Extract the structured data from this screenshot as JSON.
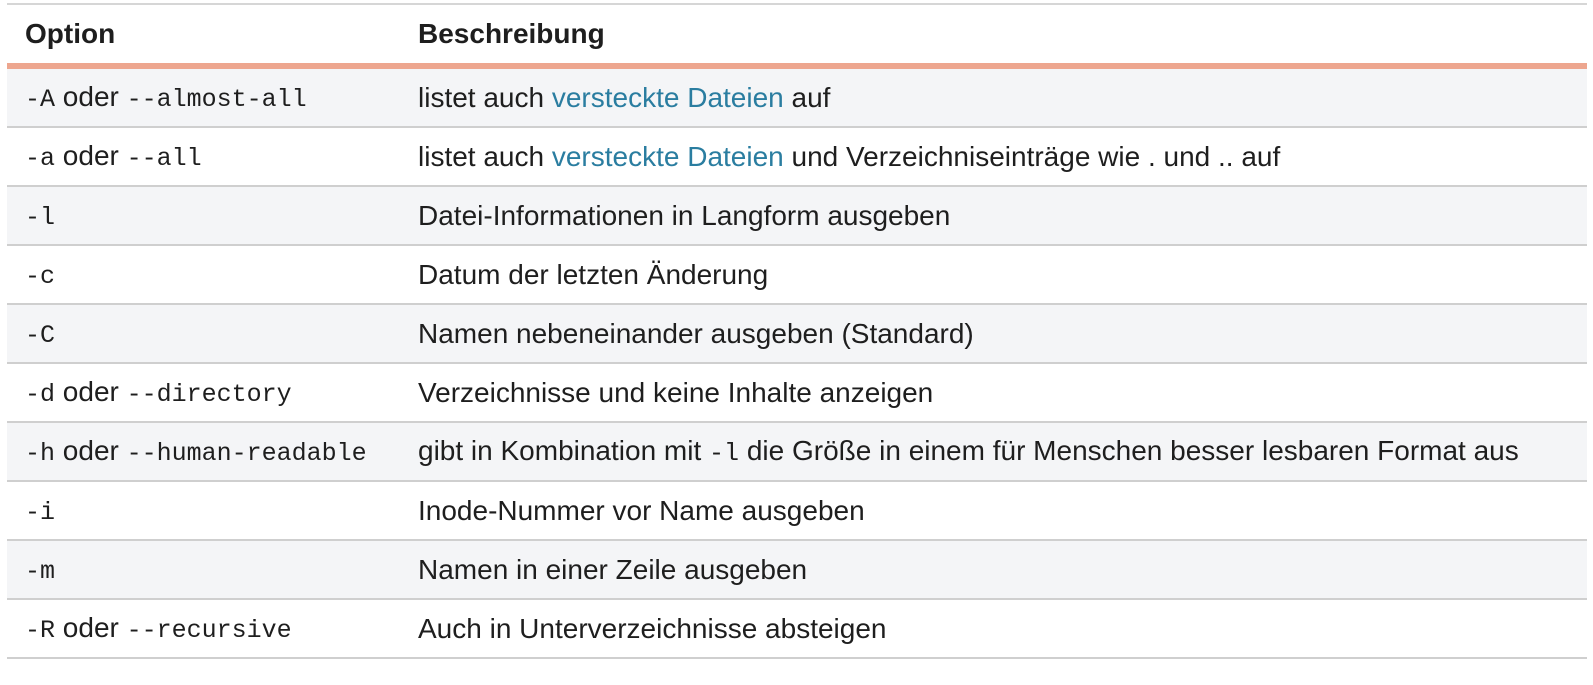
{
  "header": {
    "option": "Option",
    "description": "Beschreibung"
  },
  "rows": [
    {
      "option": [
        {
          "t": "code",
          "v": "-A"
        },
        {
          "t": "text",
          "v": " oder "
        },
        {
          "t": "code",
          "v": "--almost-all"
        }
      ],
      "description": [
        {
          "t": "text",
          "v": "listet auch "
        },
        {
          "t": "link",
          "v": "versteckte Dateien"
        },
        {
          "t": "text",
          "v": " auf"
        }
      ]
    },
    {
      "option": [
        {
          "t": "code",
          "v": "-a"
        },
        {
          "t": "text",
          "v": " oder "
        },
        {
          "t": "code",
          "v": "--all"
        }
      ],
      "description": [
        {
          "t": "text",
          "v": "listet auch "
        },
        {
          "t": "link",
          "v": "versteckte Dateien"
        },
        {
          "t": "text",
          "v": " und Verzeichniseinträge wie . und .. auf"
        }
      ]
    },
    {
      "option": [
        {
          "t": "code",
          "v": "-l"
        }
      ],
      "description": [
        {
          "t": "text",
          "v": "Datei-Informationen in Langform ausgeben"
        }
      ]
    },
    {
      "option": [
        {
          "t": "code",
          "v": "-c"
        }
      ],
      "description": [
        {
          "t": "text",
          "v": "Datum der letzten Änderung"
        }
      ]
    },
    {
      "option": [
        {
          "t": "code",
          "v": "-C"
        }
      ],
      "description": [
        {
          "t": "text",
          "v": "Namen nebeneinander ausgeben (Standard)"
        }
      ]
    },
    {
      "option": [
        {
          "t": "code",
          "v": "-d"
        },
        {
          "t": "text",
          "v": " oder "
        },
        {
          "t": "code",
          "v": "--directory"
        }
      ],
      "description": [
        {
          "t": "text",
          "v": "Verzeichnisse und keine Inhalte anzeigen"
        }
      ]
    },
    {
      "option": [
        {
          "t": "code",
          "v": "-h"
        },
        {
          "t": "text",
          "v": " oder "
        },
        {
          "t": "code",
          "v": "--human-readable"
        }
      ],
      "description": [
        {
          "t": "text",
          "v": "gibt in Kombination mit "
        },
        {
          "t": "code",
          "v": "-l"
        },
        {
          "t": "text",
          "v": " die Größe in einem für Menschen besser lesbaren Format aus"
        }
      ]
    },
    {
      "option": [
        {
          "t": "code",
          "v": "-i"
        }
      ],
      "description": [
        {
          "t": "text",
          "v": "Inode-Nummer vor Name ausgeben"
        }
      ]
    },
    {
      "option": [
        {
          "t": "code",
          "v": "-m"
        }
      ],
      "description": [
        {
          "t": "text",
          "v": "Namen in einer Zeile ausgeben"
        }
      ]
    },
    {
      "option": [
        {
          "t": "code",
          "v": "-R"
        },
        {
          "t": "text",
          "v": " oder "
        },
        {
          "t": "code",
          "v": "--recursive"
        }
      ],
      "description": [
        {
          "t": "text",
          "v": "Auch in Unterverzeichnisse absteigen"
        }
      ]
    }
  ],
  "colors": {
    "header_rule": "#eda68f",
    "link": "#2a7da0",
    "row_stripe": "#f4f5f7"
  }
}
